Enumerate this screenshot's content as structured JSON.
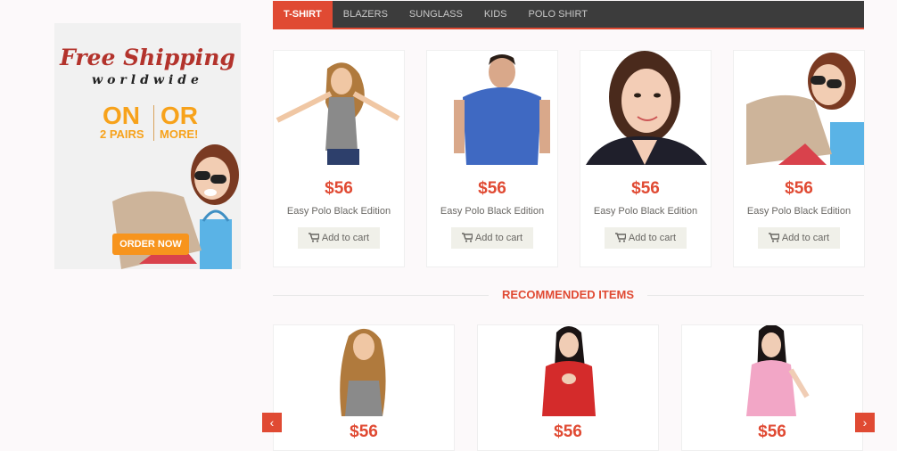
{
  "promo": {
    "title": "Free Shipping",
    "subtitle": "worldwide",
    "on": "ON",
    "or": "OR",
    "pairs": "2 PAIRS",
    "more": "MORE!",
    "cta": "ORDER NOW",
    "accent_color": "#f7a21b"
  },
  "tabs": [
    "T-SHIRT",
    "BLAZERS",
    "SUNGLASS",
    "KIDS",
    "POLO SHIRT"
  ],
  "products": [
    {
      "price": "$56",
      "name": "Easy Polo Black Edition",
      "cart_label": "Add to cart"
    },
    {
      "price": "$56",
      "name": "Easy Polo Black Edition",
      "cart_label": "Add to cart"
    },
    {
      "price": "$56",
      "name": "Easy Polo Black Edition",
      "cart_label": "Add to cart"
    },
    {
      "price": "$56",
      "name": "Easy Polo Black Edition",
      "cart_label": "Add to cart"
    }
  ],
  "recommended": {
    "title": "RECOMMENDED ITEMS",
    "items": [
      {
        "price": "$56"
      },
      {
        "price": "$56"
      },
      {
        "price": "$56"
      }
    ],
    "prev": "‹",
    "next": "›"
  },
  "colors": {
    "accent": "#e04a33",
    "tabbar": "#3c3c3c"
  }
}
